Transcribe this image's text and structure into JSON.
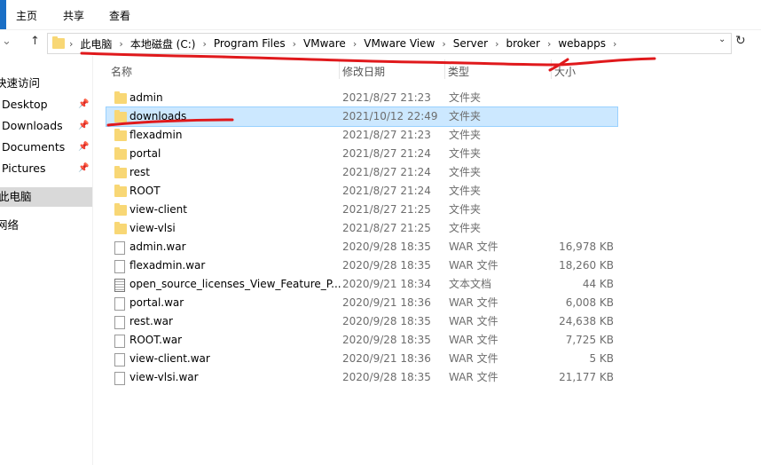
{
  "ribbon": {
    "tabs": [
      "主页",
      "共享",
      "查看"
    ]
  },
  "address": {
    "crumbs": [
      "此电脑",
      "本地磁盘 (C:)",
      "Program Files",
      "VMware",
      "VMware View",
      "Server",
      "broker",
      "webapps"
    ]
  },
  "columns": {
    "name": "名称",
    "date": "修改日期",
    "type": "类型",
    "size": "大小"
  },
  "sidebar": {
    "items": [
      {
        "label": "快速访问",
        "pinned": false
      },
      {
        "label": "Desktop",
        "pinned": true
      },
      {
        "label": "Downloads",
        "pinned": true
      },
      {
        "label": "Documents",
        "pinned": true
      },
      {
        "label": "Pictures",
        "pinned": true
      },
      {
        "label": "此电脑",
        "pinned": false,
        "selected": true
      },
      {
        "label": "网络",
        "pinned": false
      }
    ]
  },
  "files": [
    {
      "name": "admin",
      "date": "2021/8/27 21:23",
      "type": "文件夹",
      "size": "",
      "kind": "folder"
    },
    {
      "name": "downloads",
      "date": "2021/10/12 22:49",
      "type": "文件夹",
      "size": "",
      "kind": "folder",
      "selected": true
    },
    {
      "name": "flexadmin",
      "date": "2021/8/27 21:23",
      "type": "文件夹",
      "size": "",
      "kind": "folder"
    },
    {
      "name": "portal",
      "date": "2021/8/27 21:24",
      "type": "文件夹",
      "size": "",
      "kind": "folder"
    },
    {
      "name": "rest",
      "date": "2021/8/27 21:24",
      "type": "文件夹",
      "size": "",
      "kind": "folder"
    },
    {
      "name": "ROOT",
      "date": "2021/8/27 21:24",
      "type": "文件夹",
      "size": "",
      "kind": "folder"
    },
    {
      "name": "view-client",
      "date": "2021/8/27 21:25",
      "type": "文件夹",
      "size": "",
      "kind": "folder"
    },
    {
      "name": "view-vlsi",
      "date": "2021/8/27 21:25",
      "type": "文件夹",
      "size": "",
      "kind": "folder"
    },
    {
      "name": "admin.war",
      "date": "2020/9/28 18:35",
      "type": "WAR 文件",
      "size": "16,978 KB",
      "kind": "file"
    },
    {
      "name": "flexadmin.war",
      "date": "2020/9/28 18:35",
      "type": "WAR 文件",
      "size": "18,260 KB",
      "kind": "file"
    },
    {
      "name": "open_source_licenses_View_Feature_P...",
      "date": "2020/9/21 18:34",
      "type": "文本文档",
      "size": "44 KB",
      "kind": "doc"
    },
    {
      "name": "portal.war",
      "date": "2020/9/21 18:36",
      "type": "WAR 文件",
      "size": "6,008 KB",
      "kind": "file"
    },
    {
      "name": "rest.war",
      "date": "2020/9/28 18:35",
      "type": "WAR 文件",
      "size": "24,638 KB",
      "kind": "file"
    },
    {
      "name": "ROOT.war",
      "date": "2020/9/28 18:35",
      "type": "WAR 文件",
      "size": "7,725 KB",
      "kind": "file"
    },
    {
      "name": "view-client.war",
      "date": "2020/9/21 18:36",
      "type": "WAR 文件",
      "size": "5 KB",
      "kind": "file"
    },
    {
      "name": "view-vlsi.war",
      "date": "2020/9/28 18:35",
      "type": "WAR 文件",
      "size": "21,177 KB",
      "kind": "file"
    }
  ],
  "colors": {
    "selection": "#cce8ff",
    "annotation": "#e0191c",
    "folder": "#f8d775"
  }
}
